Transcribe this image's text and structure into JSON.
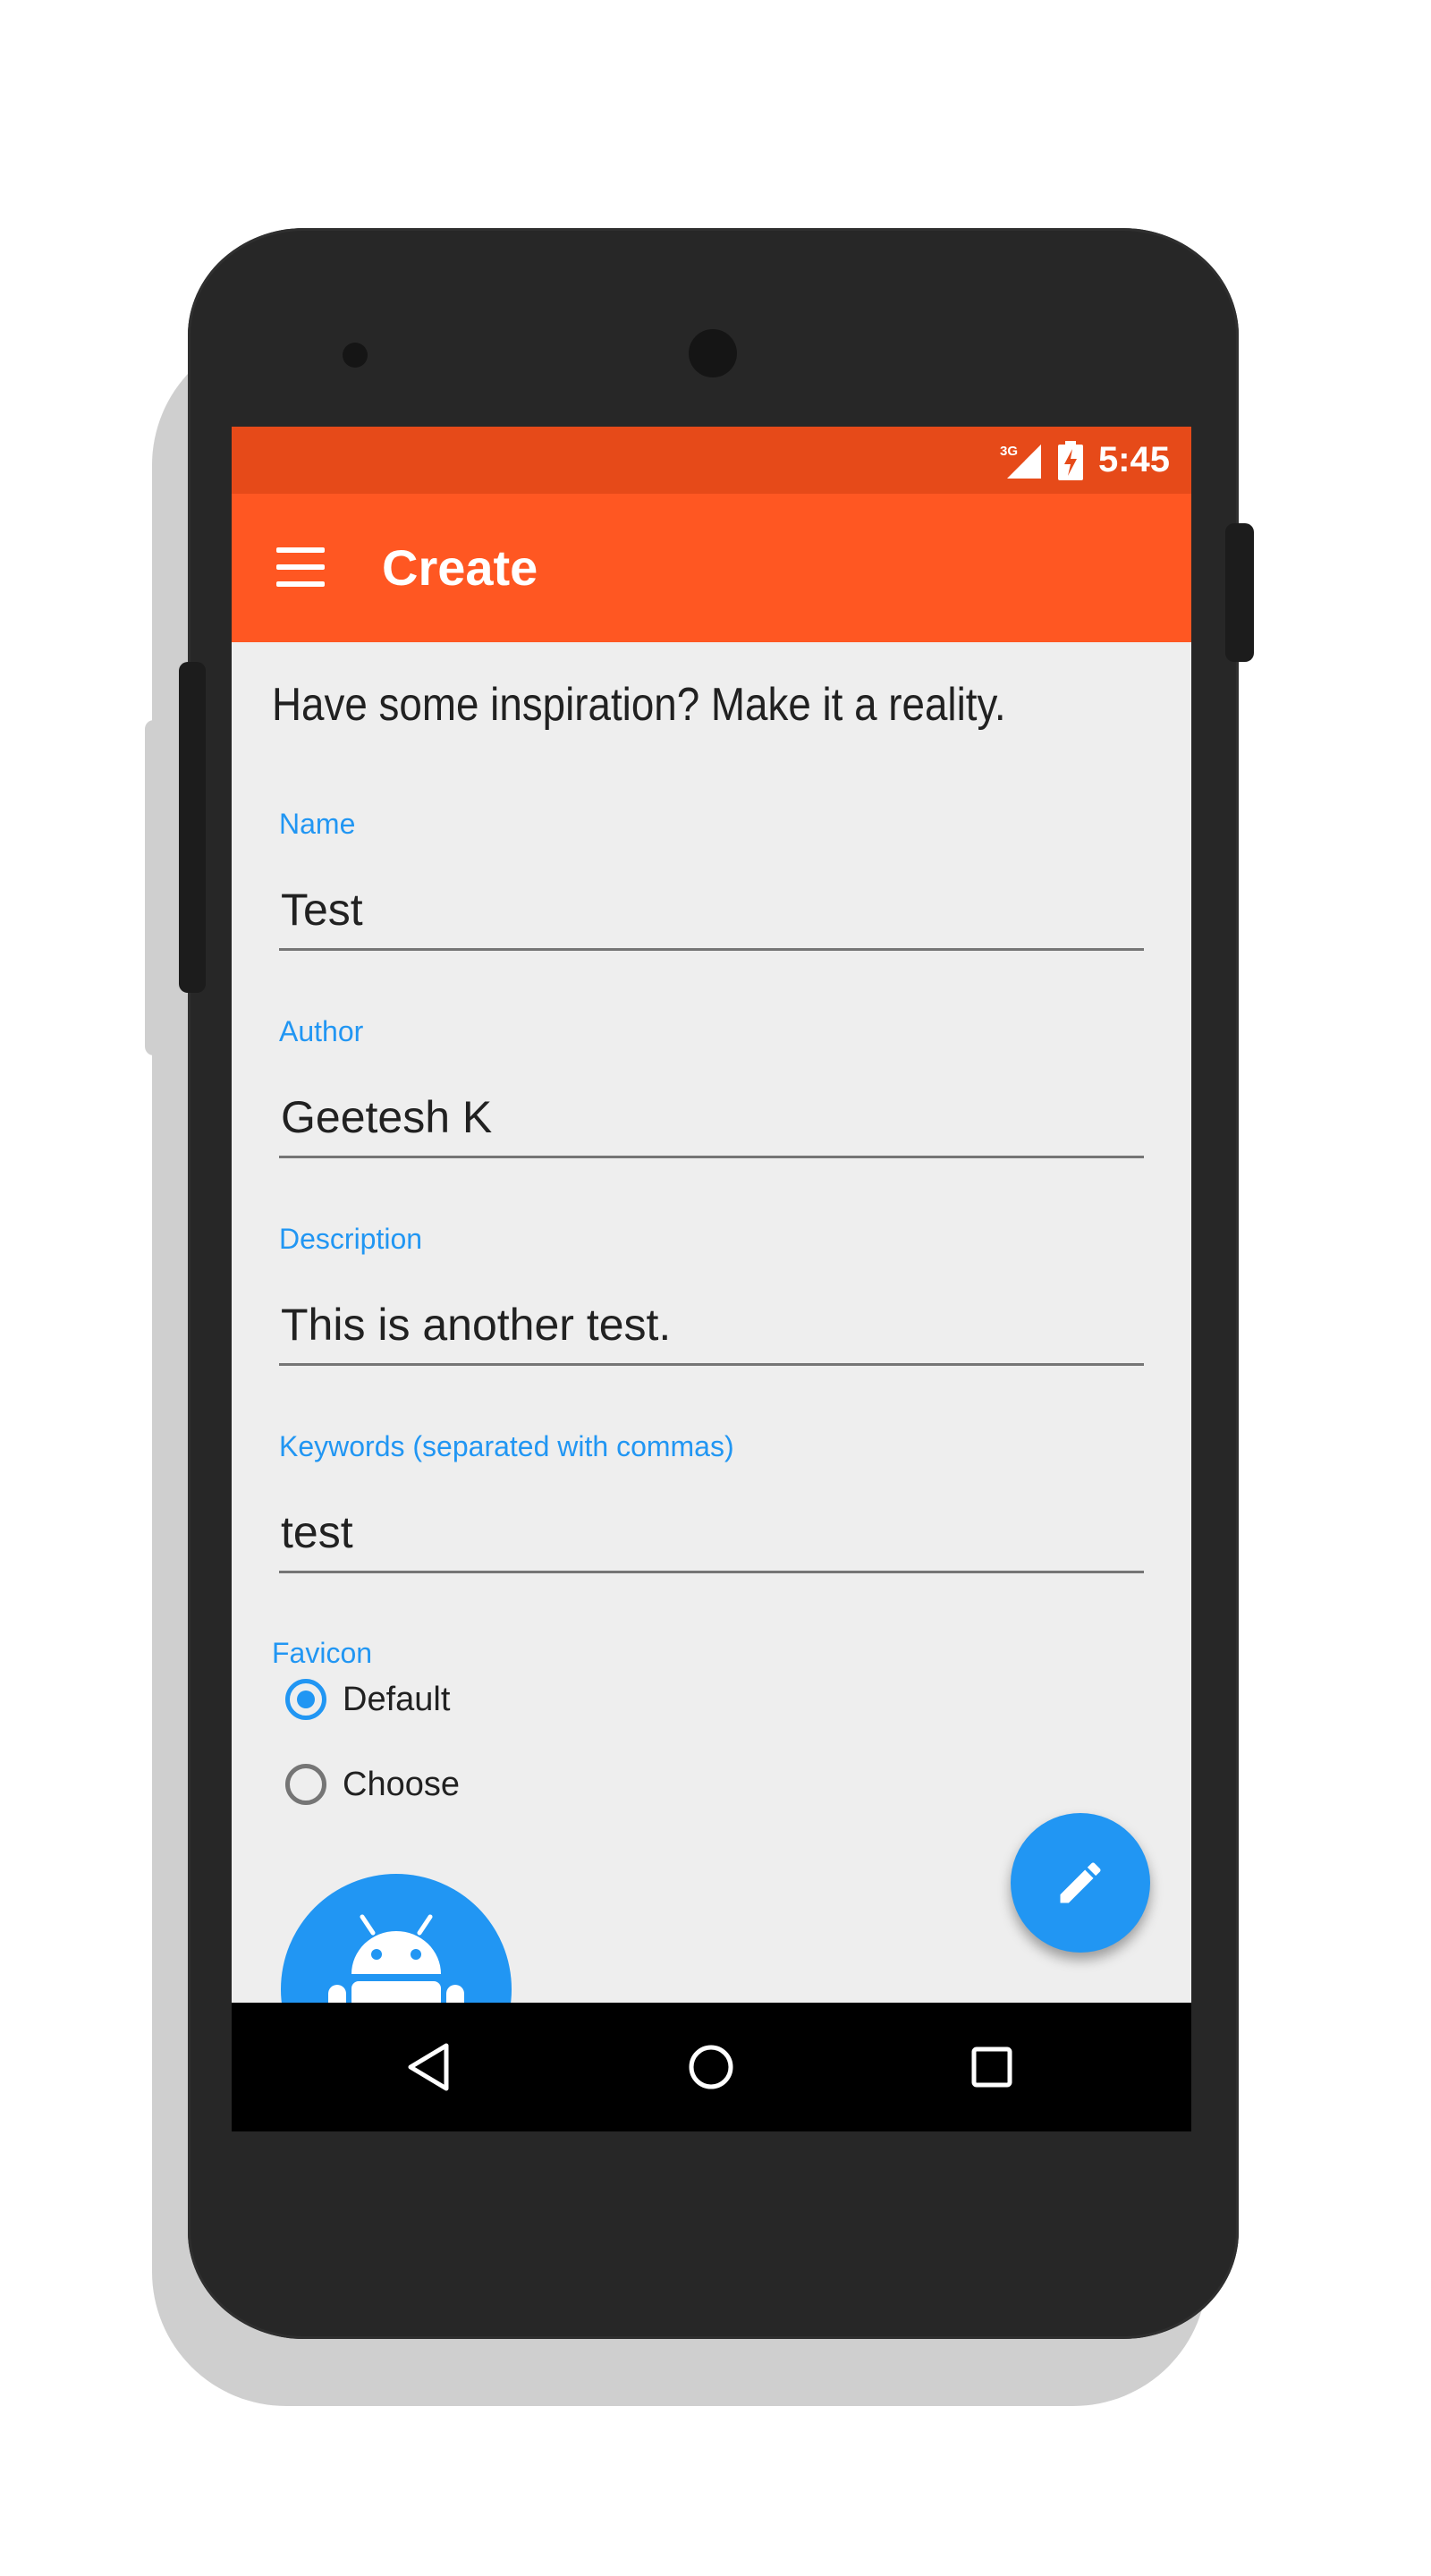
{
  "status_bar": {
    "network": "3G",
    "time": "5:45"
  },
  "app_bar": {
    "title": "Create",
    "menu_icon": "hamburger-menu-icon"
  },
  "form": {
    "headline": "Have some inspiration? Make it a reality.",
    "fields": [
      {
        "label": "Name",
        "value": "Test"
      },
      {
        "label": "Author",
        "value": "Geetesh K"
      },
      {
        "label": "Description",
        "value": "This is another test."
      },
      {
        "label": "Keywords (separated with commas)",
        "value": "test"
      }
    ],
    "favicon": {
      "label": "Favicon",
      "options": [
        {
          "label": "Default",
          "selected": true
        },
        {
          "label": "Choose",
          "selected": false
        }
      ],
      "preview_icon": "android-robot-icon"
    }
  },
  "fab": {
    "icon": "pencil-edit-icon"
  },
  "nav_bar": {
    "icons": [
      "back-triangle-icon",
      "home-circle-icon",
      "recents-square-icon"
    ]
  },
  "colors": {
    "status_bar": "#e64a19",
    "app_bar": "#ff5722",
    "accent": "#2196f3",
    "background": "#eeeeee",
    "phone_body": "#272727"
  }
}
